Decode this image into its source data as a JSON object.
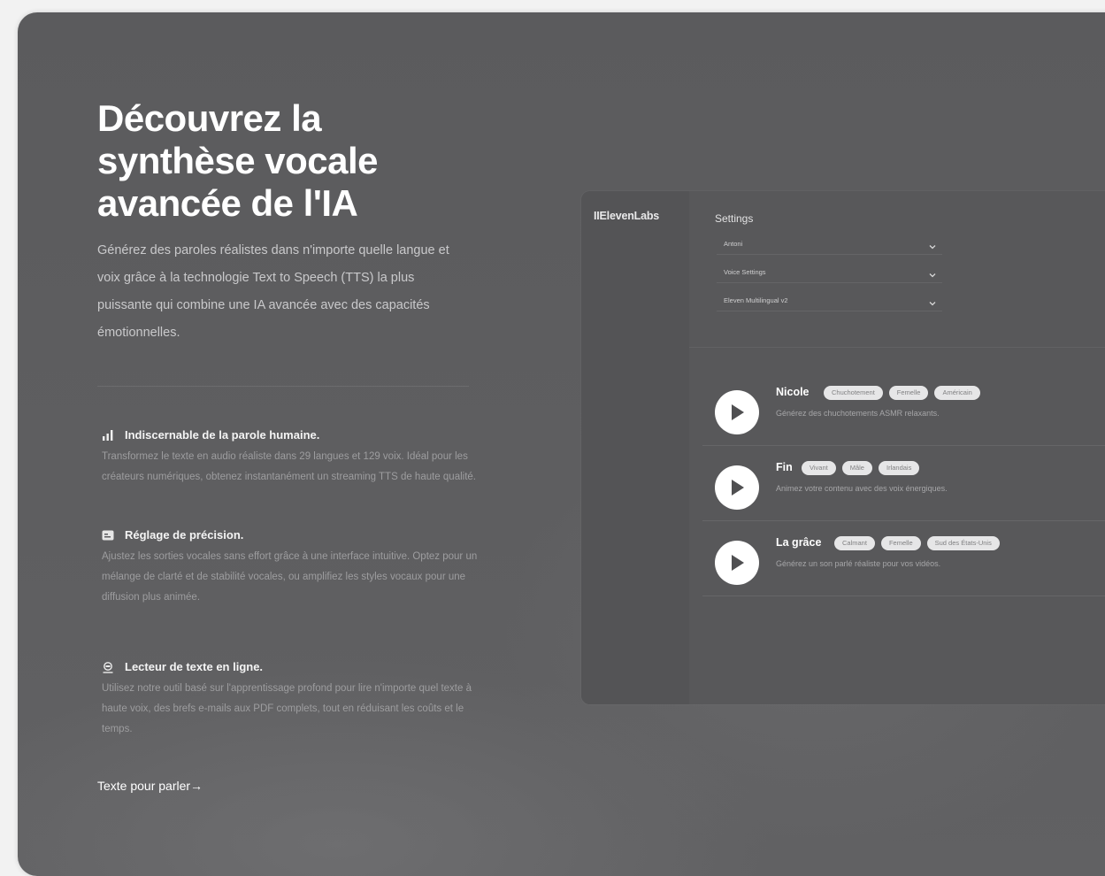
{
  "hero": {
    "title_lines": [
      "Découvrez la",
      "synthèse vocale",
      "avancée de l'IA"
    ],
    "description": "Générez des paroles réalistes dans n'importe quelle langue et voix grâce à la technologie Text to Speech (TTS) la plus puissante qui combine une IA avancée avec des capacités émotionnelles."
  },
  "features": [
    {
      "icon": "signal-bars-icon",
      "title": "Indiscernable de la parole humaine.",
      "description": "Transformez le texte en audio réaliste dans 29 langues et 129 voix. Idéal pour les créateurs numériques, obtenez instantanément un streaming TTS de haute qualité."
    },
    {
      "icon": "settings-panel-icon",
      "title": "Réglage de précision.",
      "description": "Ajustez les sorties vocales sans effort grâce à une interface intuitive. Optez pour un mélange de clarté et de stabilité vocales, ou amplifiez les styles vocaux pour une diffusion plus animée."
    },
    {
      "icon": "reader-icon",
      "title": "Lecteur de texte en ligne.",
      "description": "Utilisez notre outil basé sur l'apprentissage profond pour lire n'importe quel texte à haute voix, des brefs e-mails aux PDF complets, tout en réduisant les coûts et le temps."
    }
  ],
  "cta": {
    "label": "Texte pour parler→"
  },
  "app": {
    "brand": "IIElevenLabs",
    "settings_title": "Settings",
    "dropdowns": [
      "Antoni",
      "Voice Settings",
      "Eleven Multilingual v2"
    ],
    "voices": [
      {
        "name": "Nicole",
        "tags": [
          "Chuchotement",
          "Femelle",
          "Américain"
        ],
        "description": "Générez des chuchotements ASMR relaxants."
      },
      {
        "name": "Fin",
        "tags": [
          "Vivant",
          "Mâle",
          "Irlandais"
        ],
        "description": "Animez votre contenu avec des voix énergiques."
      },
      {
        "name": "La grâce",
        "tags": [
          "Calmant",
          "Femelle",
          "Sud des États-Unis"
        ],
        "description": "Générez un son parlé réaliste pour vos vidéos."
      }
    ]
  }
}
